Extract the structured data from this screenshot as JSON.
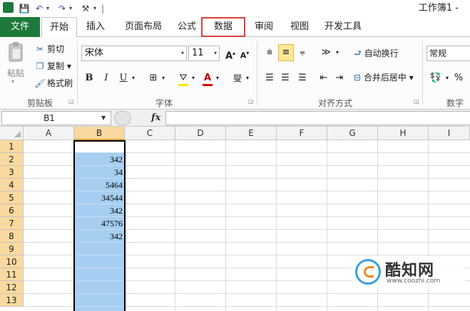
{
  "titlebar": {
    "window_title": "工作簿1 -",
    "quick_access": {
      "save": "💾",
      "undo": "↶",
      "redo": "↷",
      "customize": "⚒",
      "dropdown": "▾",
      "separator": "|"
    }
  },
  "tabs": [
    {
      "id": "file",
      "label": "文件"
    },
    {
      "id": "home",
      "label": "开始"
    },
    {
      "id": "insert",
      "label": "插入"
    },
    {
      "id": "layout",
      "label": "页面布局"
    },
    {
      "id": "formula",
      "label": "公式"
    },
    {
      "id": "data",
      "label": "数据"
    },
    {
      "id": "review",
      "label": "审阅"
    },
    {
      "id": "view",
      "label": "视图"
    },
    {
      "id": "dev",
      "label": "开发工具"
    }
  ],
  "ribbon": {
    "clipboard": {
      "group_label": "剪贴板",
      "paste": "粘贴",
      "cut": "剪切",
      "copy": "复制",
      "painter": "格式刷"
    },
    "font": {
      "group_label": "字体",
      "font_name": "宋体",
      "font_size": "11",
      "bold": "B",
      "italic": "I",
      "underline": "U",
      "grow": "A",
      "shrink": "A",
      "font_color": "A",
      "phonetic": "燮"
    },
    "alignment": {
      "group_label": "对齐方式",
      "wrap_text": "自动换行",
      "merge_center": "合并后居中"
    },
    "number": {
      "group_label": "数字",
      "format": "常规",
      "percent": "%"
    }
  },
  "formula_bar": {
    "name_box": "B1",
    "fx": "fx",
    "formula": ""
  },
  "grid": {
    "columns": [
      "A",
      "B",
      "C",
      "D",
      "E",
      "F",
      "G",
      "H",
      "I"
    ],
    "selected_column": "B",
    "rows": [
      "1",
      "2",
      "3",
      "4",
      "5",
      "6",
      "7",
      "8",
      "9",
      "10",
      "11",
      "12",
      "13"
    ],
    "columnB": [
      "342",
      "34",
      "5464",
      "34544",
      "342",
      "47576",
      "342"
    ]
  },
  "watermark": {
    "title": "酷知网",
    "url": "www.coozhi.com"
  },
  "colors": {
    "file_tab": "#1d7a3c",
    "data_highlight": "#d9413a",
    "selection": "#a6cef0",
    "header_selected": "#f9d99f"
  }
}
